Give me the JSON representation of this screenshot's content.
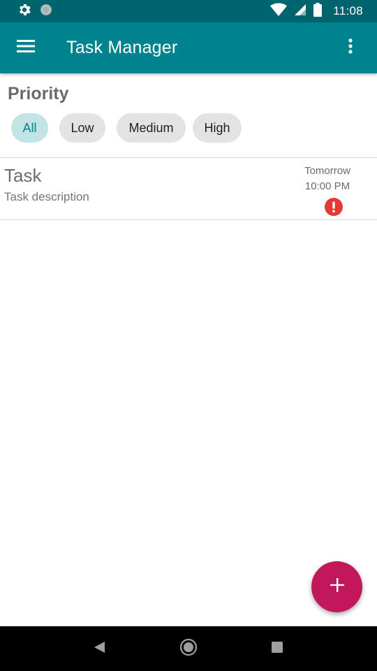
{
  "status_bar": {
    "time": "11:08",
    "left_icons": [
      "settings-icon",
      "sync-icon"
    ],
    "right_icons": [
      "wifi-icon",
      "signal-icon",
      "battery-icon"
    ]
  },
  "app_bar": {
    "title": "Task Manager",
    "menu_icon": "hamburger-menu-icon",
    "more_icon": "more-vert-icon",
    "color": "#00838f"
  },
  "filter": {
    "label": "Priority",
    "chips": [
      {
        "label": "All",
        "selected": true
      },
      {
        "label": "Low",
        "selected": false
      },
      {
        "label": "Medium",
        "selected": false
      },
      {
        "label": "High",
        "selected": false
      }
    ]
  },
  "tasks": [
    {
      "title": "Task",
      "description": "Task description",
      "due_day": "Tomorrow",
      "due_time": "10:00 PM",
      "priority_icon": "high-priority-icon",
      "priority_color": "#e53935"
    }
  ],
  "fab": {
    "icon": "add-icon",
    "color": "#c2185b"
  },
  "nav_bar": {
    "icons": [
      "back-icon",
      "home-icon",
      "recents-icon"
    ]
  }
}
